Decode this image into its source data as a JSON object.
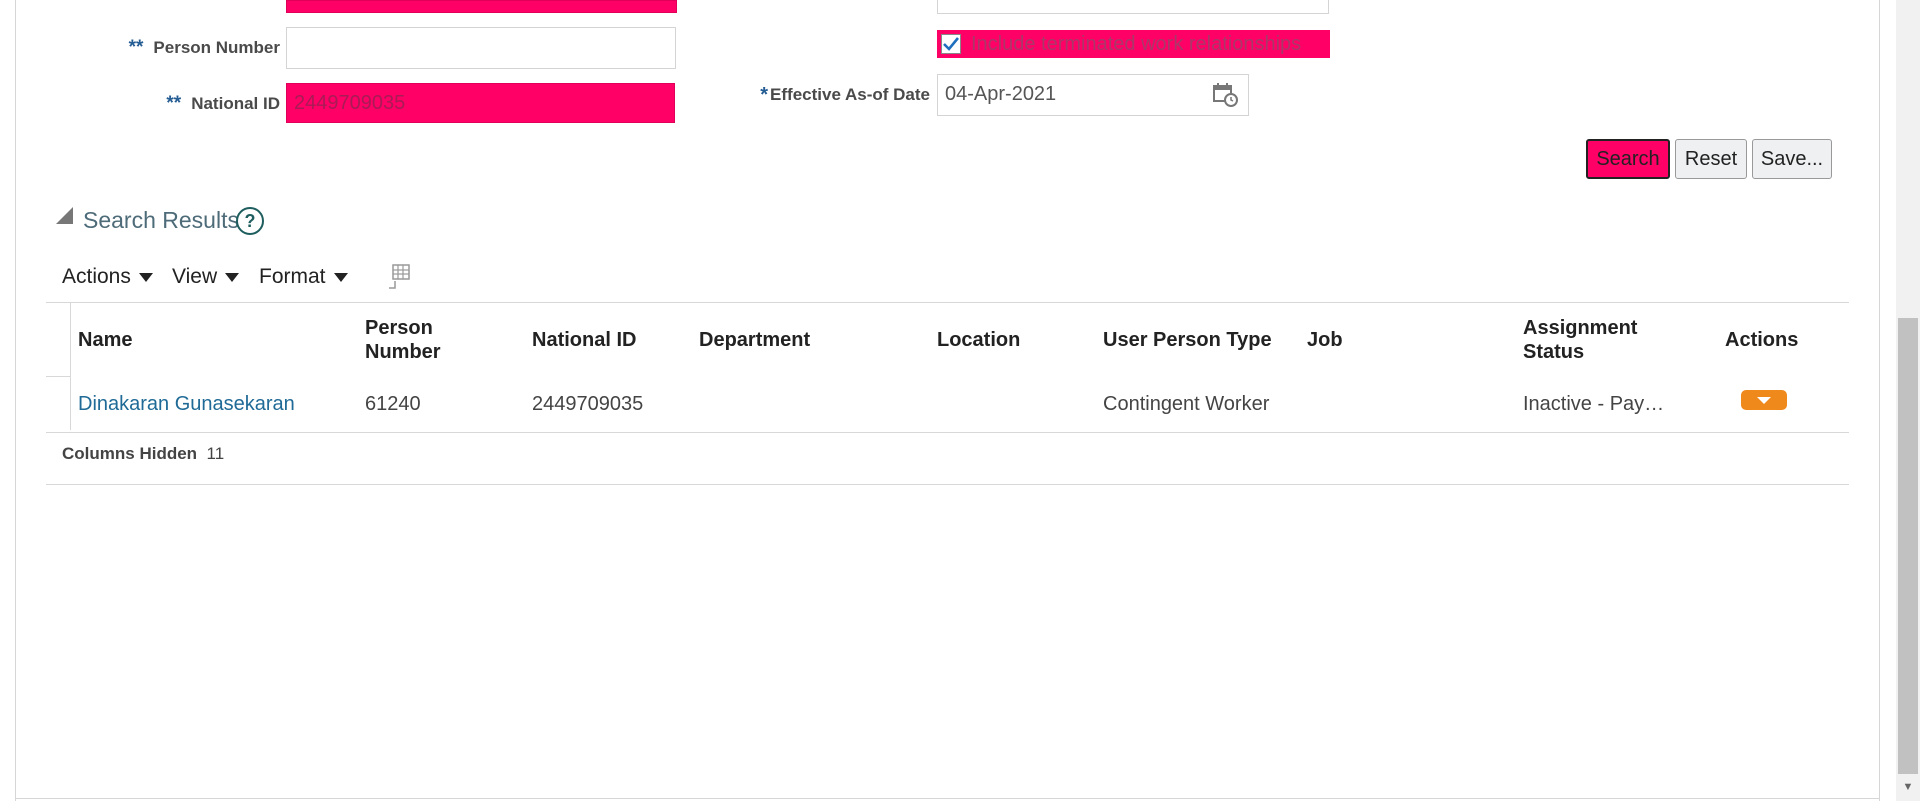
{
  "form": {
    "person_number": {
      "label": "Person Number",
      "required_mark": "**",
      "value": ""
    },
    "national_id": {
      "label": "National ID",
      "required_mark": "**",
      "value": "2449709035"
    },
    "include_terminated": {
      "label": "Include terminated work relationships",
      "checked": true
    },
    "effective_date": {
      "label": "Effective As-of Date",
      "required_mark": "*",
      "value": "04-Apr-2021"
    },
    "buttons": {
      "search": "Search",
      "reset": "Reset",
      "save": "Save..."
    }
  },
  "results": {
    "title": "Search Results",
    "help_icon": "?",
    "toolbar": {
      "actions": "Actions",
      "view": "View",
      "format": "Format"
    },
    "columns": {
      "name": "Name",
      "person_number_1": "Person",
      "person_number_2": "Number",
      "national_id": "National ID",
      "department": "Department",
      "location": "Location",
      "user_person_type": "User Person Type",
      "job": "Job",
      "assignment_status_1": "Assignment",
      "assignment_status_2": "Status",
      "actions": "Actions"
    },
    "rows": [
      {
        "name": "Dinakaran Gunasekaran",
        "person_number": "61240",
        "national_id": "2449709035",
        "department": "",
        "location": "",
        "user_person_type": "Contingent Worker",
        "job": "",
        "assignment_status": "Inactive - Pay…"
      }
    ],
    "columns_hidden_label": "Columns Hidden",
    "columns_hidden_count": "11"
  },
  "colors": {
    "highlight": "#ff0066",
    "link": "#1f6a96",
    "action_pill": "#f0891c"
  }
}
